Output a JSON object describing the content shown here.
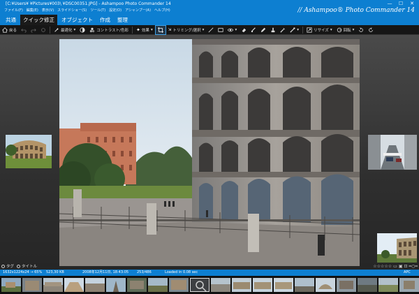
{
  "window": {
    "title": "[C:¥Users¥          ¥Pictures¥003\\          ¥DSC00351.JPG] - Ashampoo Photo Commander 14",
    "min": "—",
    "max": "☐",
    "close": "✕"
  },
  "menu": [
    "ファイル(F)",
    "編集(E)",
    "表示(V)",
    "スライドショー(S)",
    "ツール(T)",
    "設定(O)",
    "アシャンプー(A)",
    "ヘルプ(H)"
  ],
  "brand": "// Ashampoo® Photo Commander 14",
  "tabs": [
    "共通",
    "クイック修正",
    "オブジェクト",
    "作成",
    "整理"
  ],
  "toolbar": {
    "back": "戻る",
    "optimize": "最適化",
    "contrast": "コントラスト/色彩",
    "effects": "効果",
    "crop": "トリミング/選択",
    "resize": "リサイズ",
    "rotate": "回転"
  },
  "bottom_bar": {
    "tag": "タグ",
    "title": "タイトル"
  },
  "status": {
    "dimensions": "1632x1224x24 → 65%",
    "filesize": "523,30 KB",
    "date": "2008年12月11日, 18:43:05",
    "index": "253/486",
    "loaded": "Loaded in 0.08 sec",
    "apc": "APC"
  }
}
